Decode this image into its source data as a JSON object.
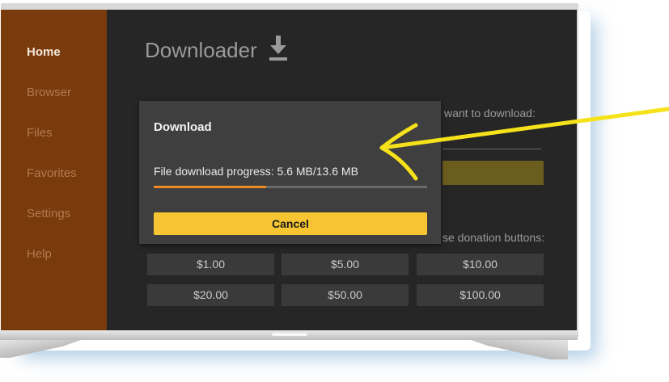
{
  "sidebar": {
    "items": [
      {
        "label": "Home",
        "active": true
      },
      {
        "label": "Browser",
        "active": false
      },
      {
        "label": "Files",
        "active": false
      },
      {
        "label": "Favorites",
        "active": false
      },
      {
        "label": "Settings",
        "active": false
      },
      {
        "label": "Help",
        "active": false
      }
    ]
  },
  "header": {
    "title": "Downloader",
    "icon": "download-icon"
  },
  "main": {
    "url_prompt_fragment": "want to download:",
    "donation_prompt_fragment": "se donation buttons:",
    "donations": [
      "$1.00",
      "$5.00",
      "$10.00",
      "$20.00",
      "$50.00",
      "$100.00"
    ]
  },
  "dialog": {
    "title": "Download",
    "progress_text": "File download progress: 5.6 MB/13.6 MB",
    "progress_fraction": 0.41,
    "cancel_label": "Cancel"
  },
  "colors": {
    "sidebar": "#7a3b0c",
    "accent_yellow": "#f6c531",
    "progress_orange": "#f08a24",
    "annotation_yellow": "#f5e21b"
  }
}
